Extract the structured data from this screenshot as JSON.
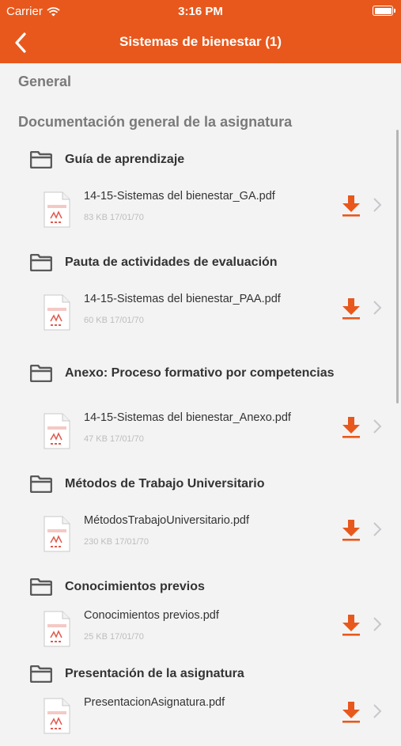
{
  "status_bar": {
    "carrier": "Carrier",
    "time": "3:16 PM"
  },
  "navbar": {
    "title": "Sistemas de bienestar (1)"
  },
  "sections": {
    "general": "General",
    "documentation": "Documentación general de la asignatura"
  },
  "folders": [
    {
      "label": "Guía de aprendizaje",
      "file": {
        "name": "14-15-Sistemas del bienestar_GA.pdf",
        "meta": "83 KB 17/01/70"
      }
    },
    {
      "label": "Pauta de actividades de evaluación",
      "file": {
        "name": "14-15-Sistemas del bienestar_PAA.pdf",
        "meta": "60 KB 17/01/70"
      }
    },
    {
      "label": "Anexo: Proceso formativo por competencias",
      "file": {
        "name": "14-15-Sistemas del bienestar_Anexo.pdf",
        "meta": "47 KB 17/01/70"
      }
    },
    {
      "label": "Métodos de Trabajo Universitario",
      "file": {
        "name": "MétodosTrabajoUniversitario.pdf",
        "meta": "230 KB 17/01/70"
      }
    },
    {
      "label": "Conocimientos previos",
      "file": {
        "name": "Conocimientos previos.pdf",
        "meta": "25 KB 17/01/70"
      }
    },
    {
      "label": "Presentación de la asignatura",
      "file": {
        "name": "PresentacionAsignatura.pdf",
        "meta": ""
      }
    }
  ],
  "colors": {
    "accent": "#e8581c",
    "background": "#f3f3f3"
  },
  "icons": {
    "back": "chevron-left-icon",
    "folder": "folder-icon",
    "file": "pdf-file-icon",
    "download": "download-icon",
    "disclosure": "chevron-right-icon"
  }
}
